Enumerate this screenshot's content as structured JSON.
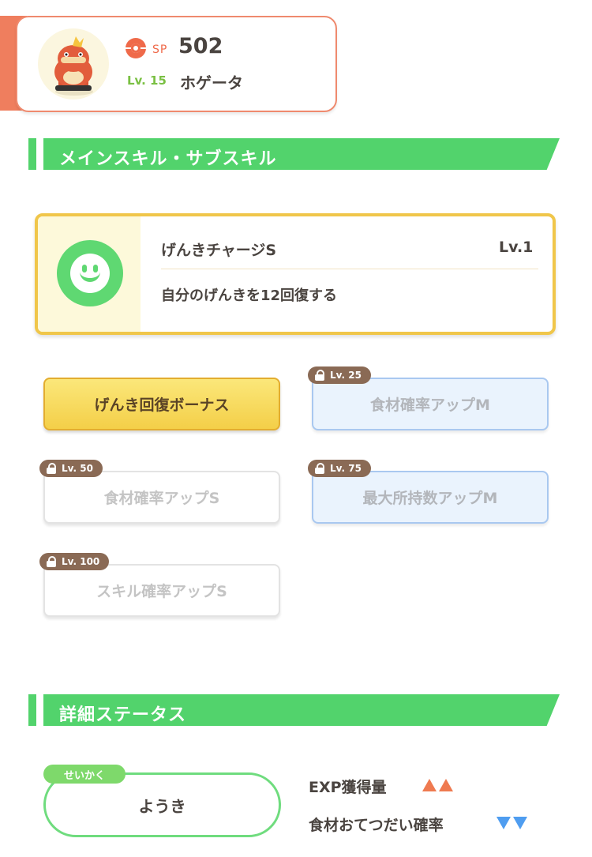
{
  "header": {
    "sp_label": "SP",
    "sp_value": "502",
    "level": "Lv. 15",
    "pokemon_name": "ホゲータ"
  },
  "sections": {
    "skills_title": "メインスキル・サブスキル",
    "detail_title": "詳細ステータス"
  },
  "main_skill": {
    "name": "げんきチャージS",
    "level": "Lv.1",
    "description": "自分のげんきを12回復する"
  },
  "sub_skills": [
    {
      "label": "げんき回復ボーナス",
      "unlocked": true
    },
    {
      "label": "食材確率アップM",
      "lock_level": "Lv. 25"
    },
    {
      "label": "食材確率アップS",
      "lock_level": "Lv. 50"
    },
    {
      "label": "最大所持数アップM",
      "lock_level": "Lv. 75"
    },
    {
      "label": "スキル確率アップS",
      "lock_level": "Lv. 100"
    }
  ],
  "nature": {
    "tag": "せいかく",
    "value": "ようき",
    "up_stat": "EXP獲得量",
    "down_stat": "食材おてつだい確率"
  },
  "colors": {
    "accent_orange": "#ef7e5e",
    "section_green": "#52d36c",
    "main_skill_gold": "#f0c64a",
    "up_arrow": "#ef7a50",
    "down_arrow": "#4f9df0"
  }
}
